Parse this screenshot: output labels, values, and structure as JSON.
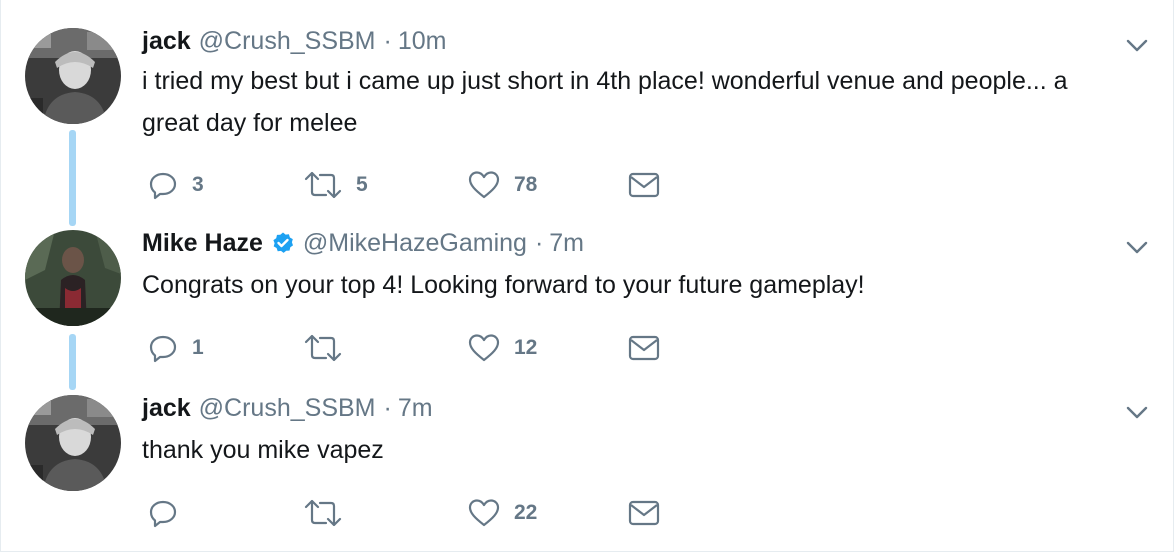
{
  "tweets": [
    {
      "name": "jack",
      "handle": "@Crush_SSBM",
      "separator": "·",
      "time": "10m",
      "text": "i tried my best but i came up just short in 4th place! wonderful venue and people... a great day for melee",
      "reply_count": "3",
      "retweet_count": "5",
      "like_count": "78",
      "verified": false
    },
    {
      "name": "Mike Haze",
      "handle": "@MikeHazeGaming",
      "separator": "·",
      "time": "7m",
      "text": "Congrats on your top 4! Looking forward to your future gameplay!",
      "reply_count": "1",
      "retweet_count": "",
      "like_count": "12",
      "verified": true
    },
    {
      "name": "jack",
      "handle": "@Crush_SSBM",
      "separator": "·",
      "time": "7m",
      "text": "thank you mike vapez",
      "reply_count": "",
      "retweet_count": "",
      "like_count": "22",
      "verified": false
    }
  ],
  "icons": {
    "reply": "reply-icon",
    "retweet": "retweet-icon",
    "like": "heart-icon",
    "message": "envelope-icon",
    "more": "chevron-down-icon",
    "verified": "verified-badge-icon"
  },
  "colors": {
    "text": "#14171a",
    "secondary": "#657786",
    "thread_line": "#a6d6f5",
    "verified": "#1da1f2",
    "border": "#e6ecf0"
  }
}
